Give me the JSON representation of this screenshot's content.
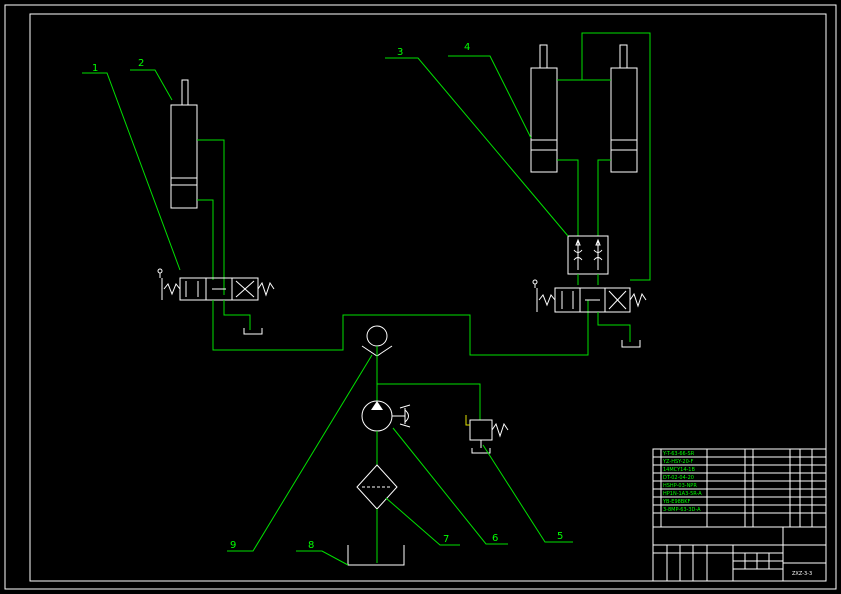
{
  "callouts": [
    "1",
    "2",
    "3",
    "4",
    "5",
    "6",
    "7",
    "8",
    "9"
  ],
  "parts_list": [
    "Y-T-63-66-SR",
    "YZ-HSY-20-F",
    "14MCY14-1B",
    "DT-02-04-20",
    "HSHP-03-NPR",
    "HP1N-1A3-5R-A",
    "YB-E98BKF",
    "3-8MP-63-3D-A"
  ],
  "title_block": {
    "drawing_no": "ZXZ-3-3"
  },
  "colors": {
    "background": "#000000",
    "frame": "#ffffff",
    "pipe": "#00e000",
    "component": "#ffffff"
  }
}
